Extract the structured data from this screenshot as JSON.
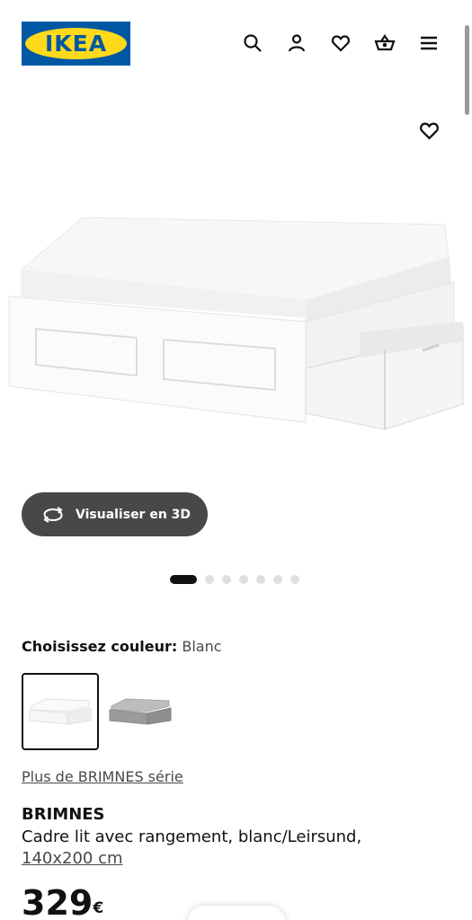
{
  "header": {
    "logo_text": "IKEA",
    "icons": [
      "search-icon",
      "user-icon",
      "heart-icon",
      "basket-icon",
      "menu-icon"
    ]
  },
  "hero": {
    "favourite_icon": "heart-icon",
    "view_3d_label": "Visualiser en 3D",
    "view_3d_icon": "rotate-icon",
    "gallery_count": 7,
    "gallery_active_index": 0
  },
  "color_selector": {
    "label": "Choisissez couleur:",
    "value": "Blanc",
    "options": [
      {
        "name": "Blanc",
        "selected": true
      },
      {
        "name": "Gris",
        "selected": false
      }
    ]
  },
  "product": {
    "series_link": "Plus de BRIMNES série",
    "name": "BRIMNES",
    "description": "Cadre lit avec rangement, blanc/Leirsund,",
    "size": "140x200 cm",
    "price": "329",
    "currency": "€"
  },
  "colors": {
    "brand_blue": "#0058a3",
    "brand_yellow": "#ffda1a",
    "button_dark": "#484848"
  }
}
